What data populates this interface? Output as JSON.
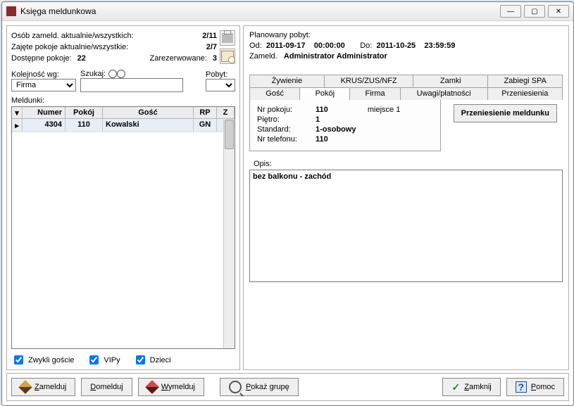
{
  "window": {
    "title": "Księga meldunkowa"
  },
  "stats": {
    "guests_label": "Osób zameld. aktualnie/wszystkich:",
    "guests_value": "2/11",
    "rooms_label": "Zajęte pokoje aktualnie/wszystkie:",
    "rooms_value": "2/7",
    "free_label": "Dostępne pokoje:",
    "free_value": "22",
    "reserved_label": "Zarezerwowane:",
    "reserved_value": "3"
  },
  "filters": {
    "sort_label": "Kolejność wg:",
    "sort_value": "Firma",
    "search_label": "Szukaj:",
    "search_value": "",
    "stay_label": "Pobyt:",
    "stay_value": ""
  },
  "grid": {
    "caption": "Meldunki:",
    "headers": {
      "numer": "Numer",
      "pokoj": "Pokój",
      "gosc": "Gość",
      "rp": "RP",
      "z": "Z"
    },
    "rows": [
      {
        "numer": "4304",
        "pokoj": "110",
        "gosc": "Kowalski",
        "rp": "GN",
        "z": ""
      }
    ]
  },
  "checkboxes": {
    "regular": "Zwykli goście",
    "vip": "VIPy",
    "children": "Dzieci"
  },
  "planned": {
    "header": "Planowany pobyt:",
    "from_label": "Od:",
    "from_date": "2011-09-17",
    "from_time": "00:00:00",
    "to_label": "Do:",
    "to_date": "2011-10-25",
    "to_time": "23:59:59",
    "by_label": "Zameld.",
    "by_value": "Administrator Administrator"
  },
  "tabs": {
    "zywienie": "Żywienie",
    "krus": "KRUS/ZUS/NFZ",
    "zamki": "Zamki",
    "spa": "Zabiegi SPA",
    "gosc": "Gość",
    "pokoj": "Pokój",
    "firma": "Firma",
    "uwagi": "Uwagi/płatności",
    "przeniesienia": "Przeniesienia"
  },
  "room": {
    "transfer_button": "Przeniesienie meldunku",
    "nr_label": "Nr pokoju:",
    "nr_value": "110",
    "place_label": "miejsce 1",
    "floor_label": "Piętro:",
    "floor_value": "1",
    "standard_label": "Standard:",
    "standard_value": "1-osobowy",
    "phone_label": "Nr telefonu:",
    "phone_value": "110",
    "desc_label": "Opis:",
    "desc_value": "bez balkonu - zachód"
  },
  "buttons": {
    "zamelduj": "Zamelduj",
    "domelduj": "Domelduj",
    "wymelduj": "Wymelduj",
    "pokaz_grupe": "Pokaż grupę",
    "zamknij": "Zamknij",
    "pomoc": "Pomoc"
  }
}
